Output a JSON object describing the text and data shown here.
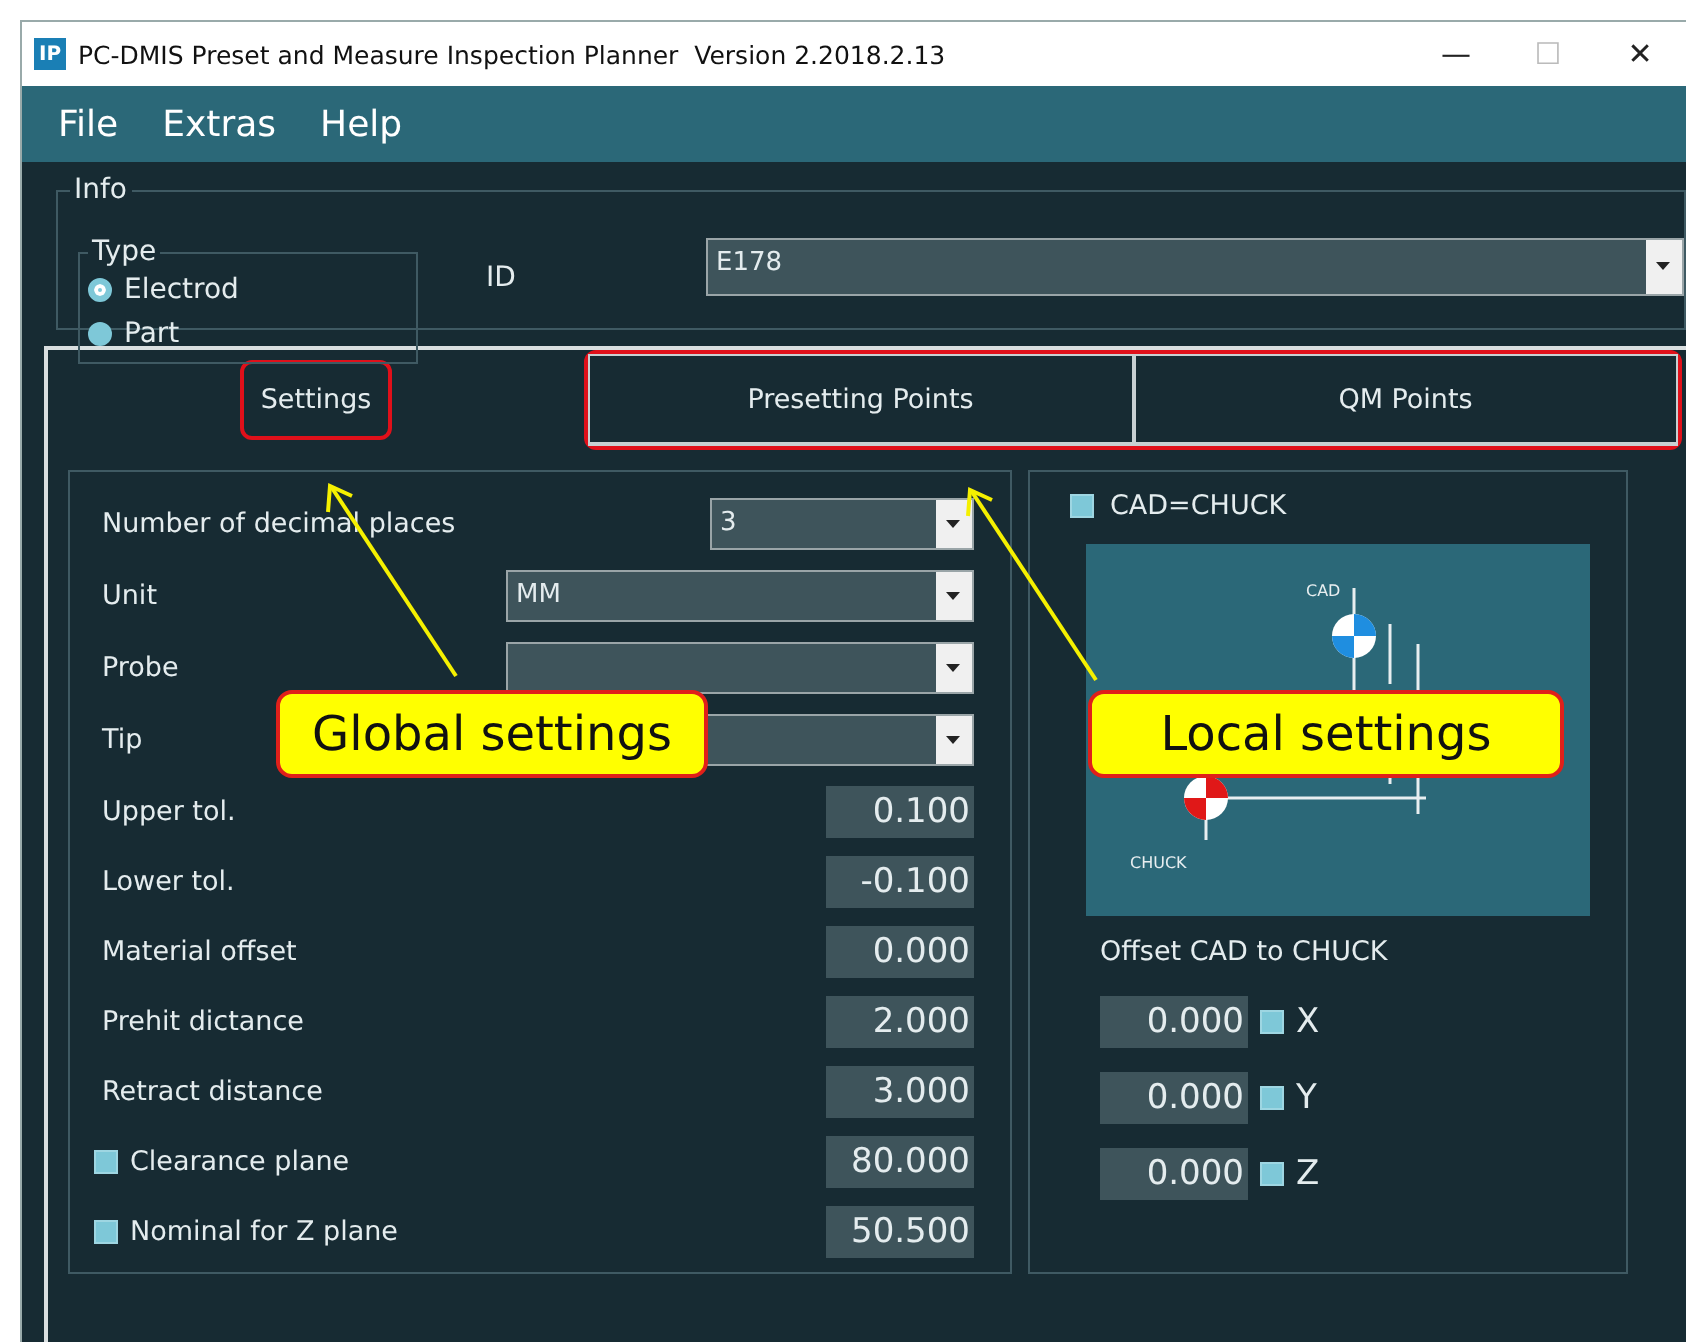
{
  "window": {
    "title": "PC-DMIS Preset and Measure Inspection Planner  Version 2.2018.2.13",
    "logo": "IP",
    "controls": [
      "—",
      "☐",
      "✕"
    ]
  },
  "menu": [
    "File",
    "Extras",
    "Help"
  ],
  "info": {
    "legend": "Info",
    "type": {
      "legend": "Type",
      "options": [
        {
          "label": "Electrod",
          "selected": true
        },
        {
          "label": "Part",
          "selected": false
        }
      ]
    },
    "id_label": "ID",
    "id_value": "E178"
  },
  "tabs": [
    {
      "label": "Settings",
      "selected": true,
      "highlighted": true
    },
    {
      "label": "Presetting Points",
      "selected": false,
      "highlighted": true
    },
    {
      "label": "QM Points",
      "selected": false,
      "highlighted": true
    }
  ],
  "settings": [
    {
      "kind": "dropdown",
      "label": "Number of decimal places",
      "value": "3"
    },
    {
      "kind": "dropdown",
      "label": "Unit",
      "value": "MM"
    },
    {
      "kind": "dropdown",
      "label": "Probe"
    },
    {
      "kind": "dropdown",
      "label": "Tip"
    },
    {
      "kind": "number",
      "label": "Upper tol.",
      "value": "0.100"
    },
    {
      "kind": "number",
      "label": "Lower tol.",
      "value": "-0.100"
    },
    {
      "kind": "number",
      "label": "Material offset",
      "value": "0.000"
    },
    {
      "kind": "number",
      "label": "Prehit dictance",
      "value": "2.000"
    },
    {
      "kind": "number",
      "label": "Retract distance",
      "value": "3.000"
    },
    {
      "kind": "check",
      "label": "Clearance plane",
      "checked": false,
      "value": "80.000"
    },
    {
      "kind": "check",
      "label": "Nominal for Z plane",
      "checked": false,
      "value": "50.500"
    }
  ],
  "local": {
    "cad_chuck": {
      "label": "CAD=CHUCK",
      "checked": false
    },
    "diagram": {
      "cad_label": "CAD",
      "chuck_label": "CHUCK"
    },
    "offset_label": "Offset CAD to CHUCK",
    "offsets": [
      {
        "value": "0.000",
        "axis": "X",
        "checked": false
      },
      {
        "value": "0.000",
        "axis": "Y",
        "checked": false
      },
      {
        "value": "0.000",
        "axis": "Z",
        "checked": false
      }
    ]
  },
  "callouts": [
    {
      "text": "Global settings"
    },
    {
      "text": "Local settings"
    }
  ]
}
